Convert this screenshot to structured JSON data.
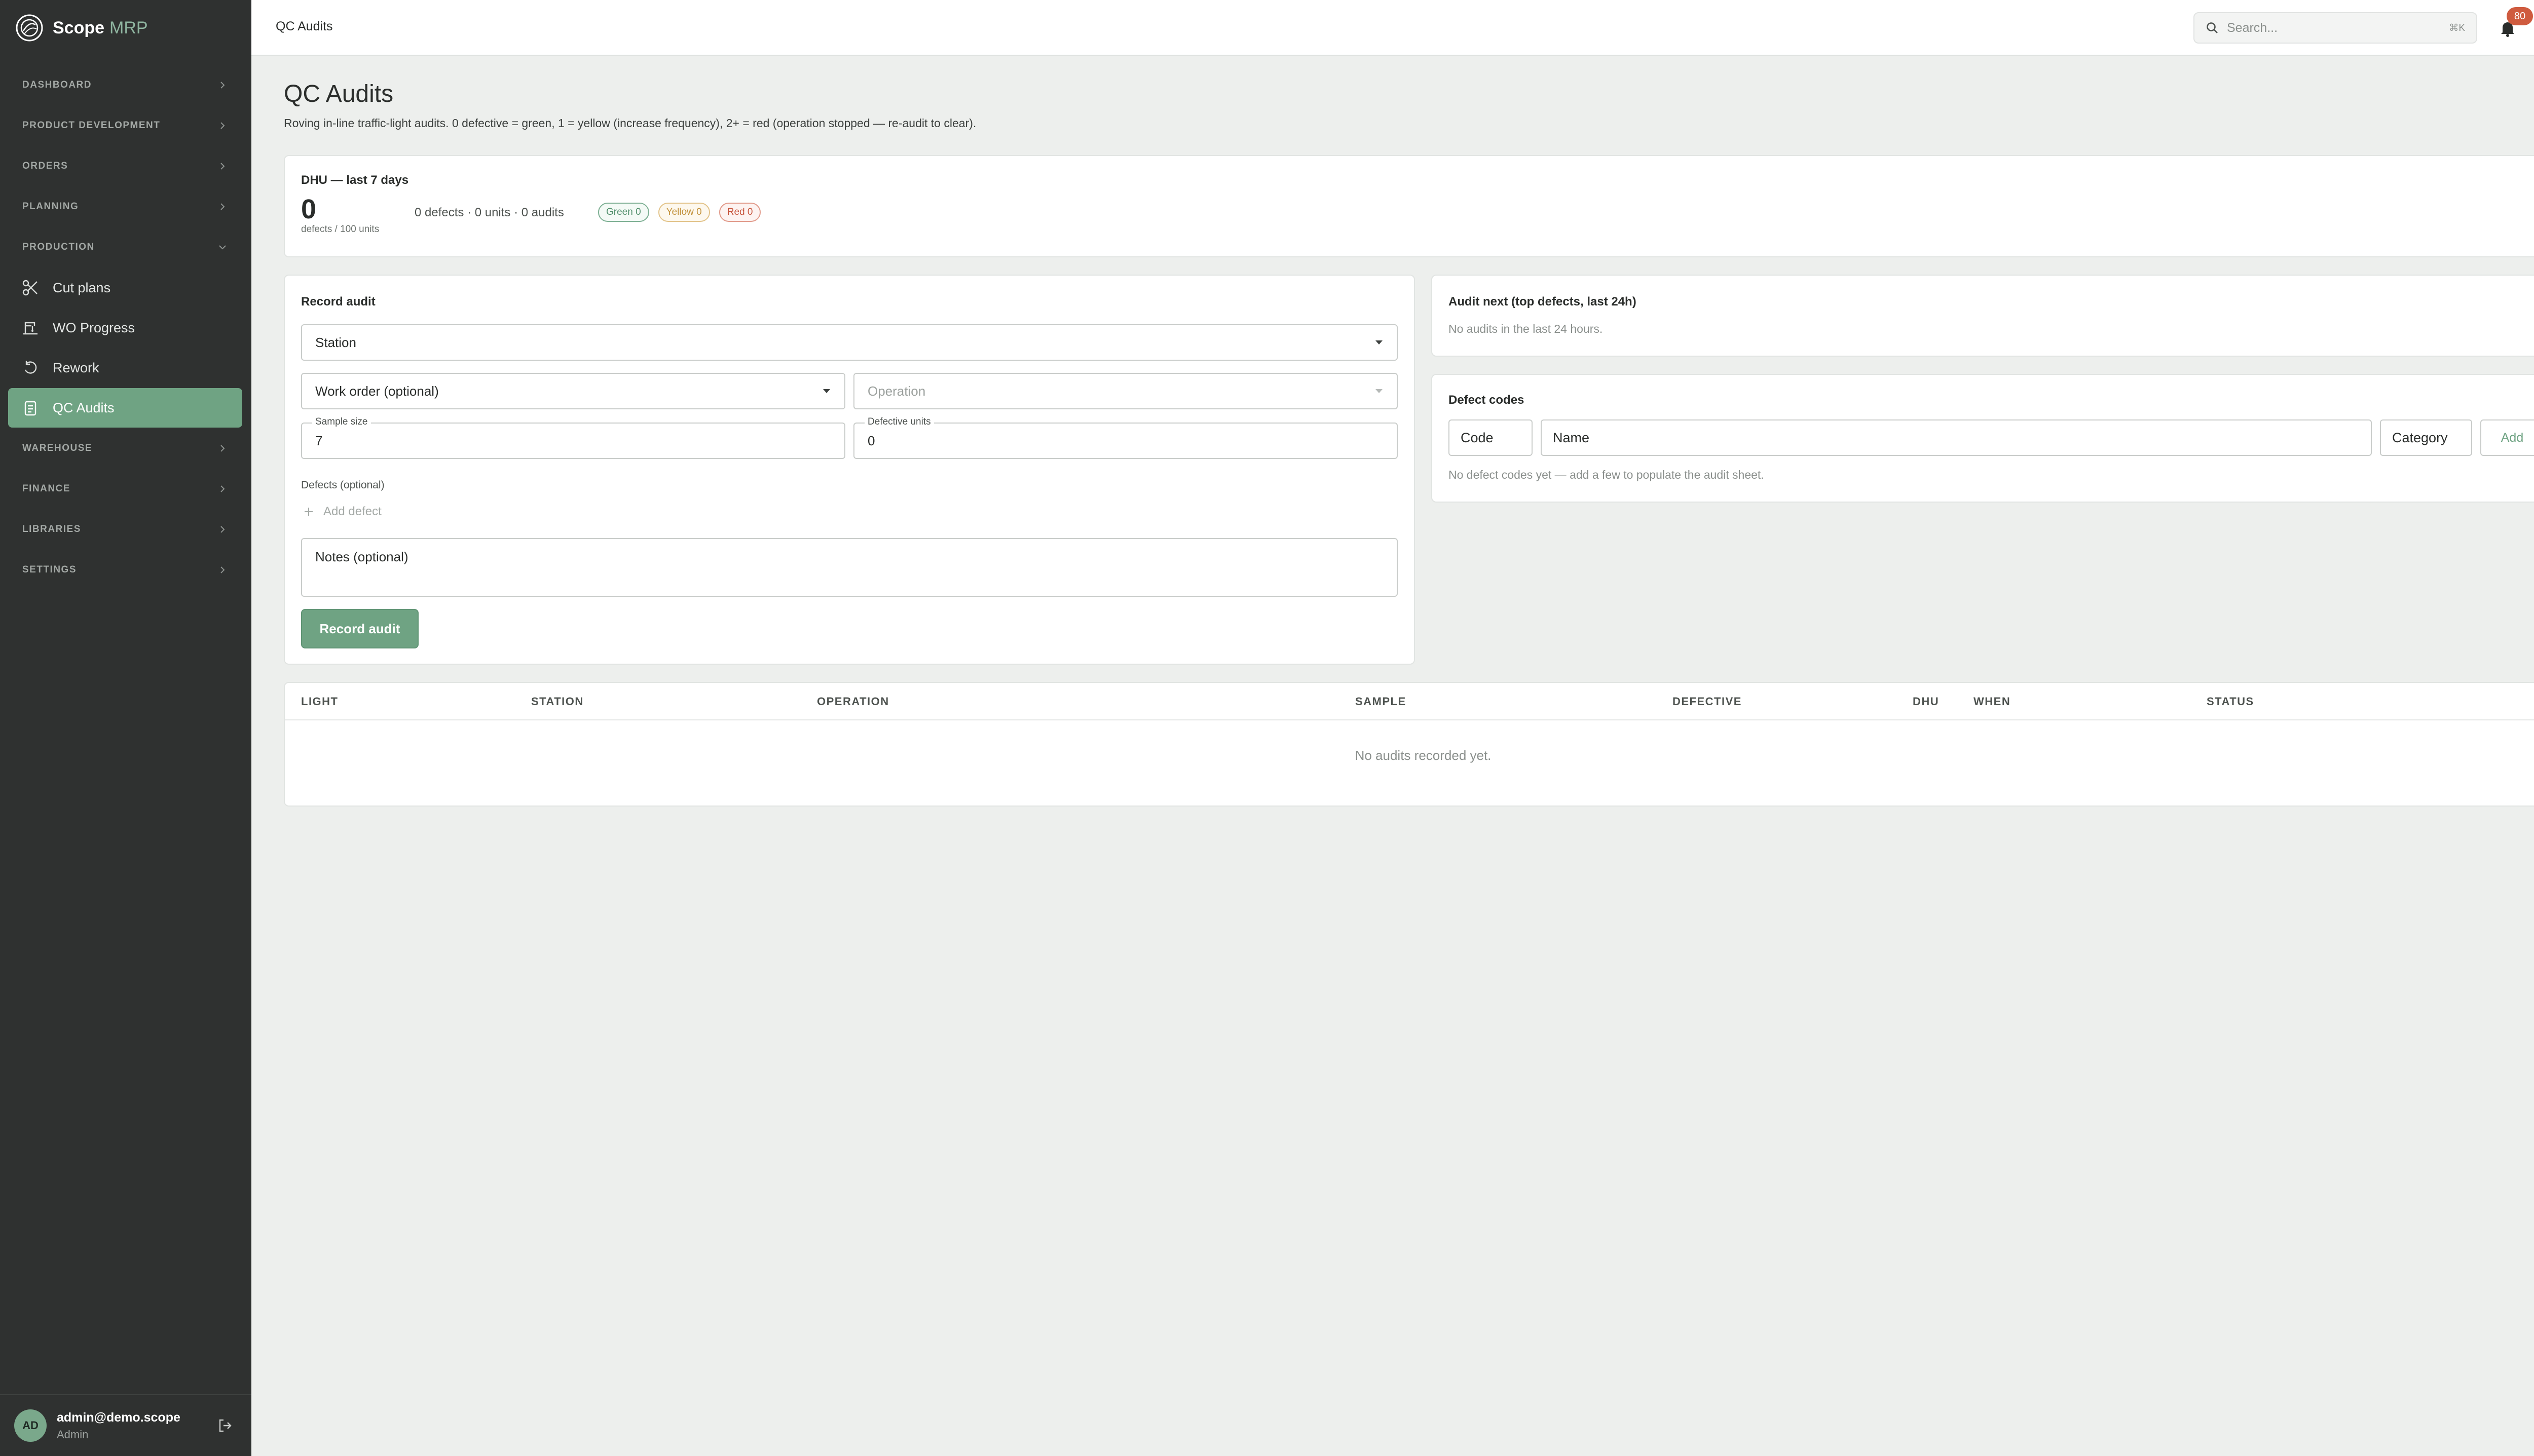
{
  "brand": {
    "name": "Scope",
    "suffix": "MRP"
  },
  "sidebar": {
    "sections": [
      {
        "label": "DASHBOARD"
      },
      {
        "label": "PRODUCT DEVELOPMENT"
      },
      {
        "label": "ORDERS"
      },
      {
        "label": "PLANNING"
      },
      {
        "label": "PRODUCTION",
        "expanded": true
      },
      {
        "label": "WAREHOUSE"
      },
      {
        "label": "FINANCE"
      },
      {
        "label": "LIBRARIES"
      },
      {
        "label": "SETTINGS"
      }
    ],
    "production_items": [
      {
        "label": "Cut plans",
        "icon": "scissors-icon"
      },
      {
        "label": "WO Progress",
        "icon": "sewing-machine-icon"
      },
      {
        "label": "Rework",
        "icon": "rework-icon"
      },
      {
        "label": "QC Audits",
        "icon": "clipboard-check-icon",
        "active": true
      }
    ],
    "user": {
      "initials": "AD",
      "email": "admin@demo.scope",
      "role": "Admin"
    }
  },
  "topbar": {
    "breadcrumb": "QC Audits",
    "search_placeholder": "Search...",
    "search_shortcut": "⌘K",
    "notification_count": "80"
  },
  "page": {
    "title": "QC Audits",
    "description": "Roving in-line traffic-light audits. 0 defective = green, 1 = yellow (increase frequency), 2+ = red (operation stopped — re-audit to clear)."
  },
  "dhu": {
    "title": "DHU — last 7 days",
    "value": "0",
    "unit": "defects / 100 units",
    "stats": "0 defects · 0 units · 0 audits",
    "pills": {
      "green": "Green 0",
      "yellow": "Yellow 0",
      "red": "Red 0"
    }
  },
  "record_audit": {
    "title": "Record audit",
    "station_placeholder": "Station",
    "work_order_placeholder": "Work order (optional)",
    "operation_placeholder": "Operation",
    "sample_size_label": "Sample size",
    "sample_size_value": "7",
    "defective_units_label": "Defective units",
    "defective_units_value": "0",
    "defects_label": "Defects (optional)",
    "add_defect_label": "Add defect",
    "notes_placeholder": "Notes (optional)",
    "submit_label": "Record audit"
  },
  "audit_next": {
    "title": "Audit next (top defects, last 24h)",
    "empty": "No audits in the last 24 hours."
  },
  "defect_codes": {
    "title": "Defect codes",
    "code_placeholder": "Code",
    "name_placeholder": "Name",
    "category_placeholder": "Category",
    "add_label": "Add",
    "empty": "No defect codes yet — add a few to populate the audit sheet."
  },
  "audits_table": {
    "columns": [
      "LIGHT",
      "STATION",
      "OPERATION",
      "SAMPLE",
      "DEFECTIVE",
      "DHU",
      "WHEN",
      "STATUS"
    ],
    "empty": "No audits recorded yet."
  },
  "colors": {
    "sidebar_bg": "#2f3130",
    "accent": "#6fa383",
    "badge": "#cf5b3f"
  }
}
